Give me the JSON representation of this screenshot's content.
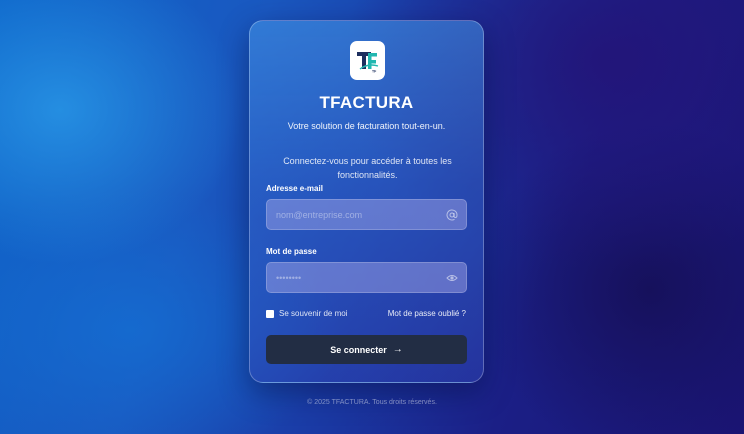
{
  "brand": {
    "logo_icon": "tfactura-logo",
    "logo_text": "TF",
    "name": "TFACTURA",
    "tagline": "Votre solution de facturation tout-en-un."
  },
  "intro": "Connectez-vous pour accéder à toutes les fonctionnalités.",
  "email": {
    "label": "Adresse e-mail",
    "placeholder": "nom@entreprise.com",
    "value": "",
    "icon": "at-sign-icon"
  },
  "password": {
    "label": "Mot de passe",
    "placeholder": "••••••••",
    "value": "",
    "icon": "eye-icon"
  },
  "remember": {
    "label": "Se souvenir de moi",
    "checked": false
  },
  "forgot_label": "Mot de passe oublié ?",
  "submit": {
    "label": "Se connecter",
    "icon": "arrow-right-icon"
  },
  "footer": "© 2025 TFACTURA. Tous droits réservés.",
  "colors": {
    "button_bg": "#222d44",
    "logo_dark": "#1d2f5e",
    "logo_accent": "#22b7b0"
  }
}
